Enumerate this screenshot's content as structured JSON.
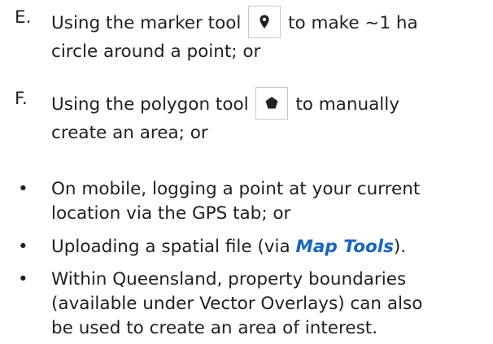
{
  "items": [
    {
      "marker": "E.",
      "before_icon": "Using the marker tool",
      "icon": "map-marker-icon",
      "after_icon": " to make ~1 ha",
      "line2": "circle around a point; or"
    },
    {
      "marker": "F.",
      "before_icon": "Using the polygon tool",
      "icon": "pentagon-polygon-icon",
      "after_icon": " to manually",
      "line2": "create an area; or"
    }
  ],
  "bullets": [
    {
      "marker": "•",
      "line1": "On mobile, logging a point at your current",
      "line2": "location via the GPS tab; or"
    },
    {
      "marker": "•",
      "prefix": "Uploading a spatial file (via ",
      "link": "Map Tools",
      "suffix": ")."
    },
    {
      "marker": "•",
      "line1": "Within Queensland, property boundaries",
      "line2": "(available under Vector Overlays) can also",
      "line3": "be used to create an area of interest."
    }
  ],
  "colors": {
    "text": "#1f1f1f",
    "link": "#1565c0",
    "icon_border": "#c8c8c8",
    "icon_fill": "#222222"
  }
}
